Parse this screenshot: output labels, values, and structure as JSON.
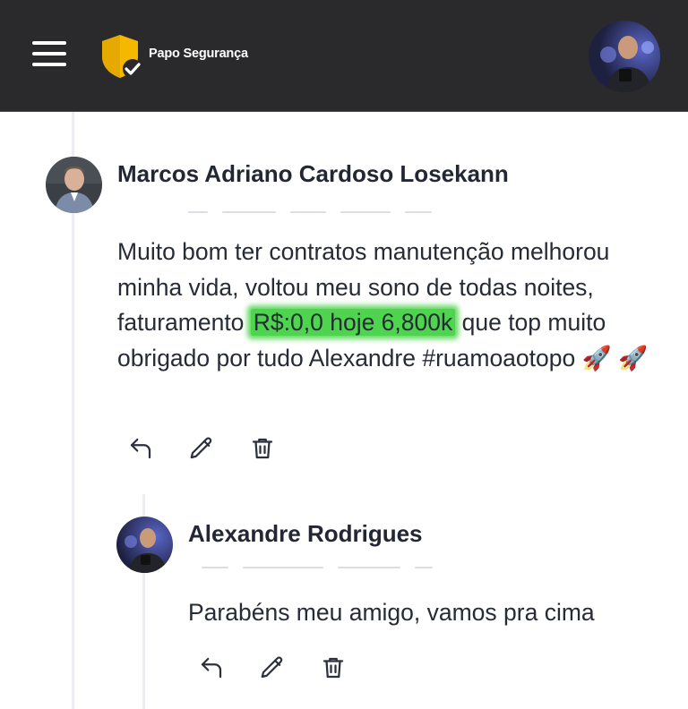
{
  "header": {
    "brand_name": "Papo Segurança",
    "menu_icon": "hamburger-menu-icon",
    "logo_icon": "shield-check-icon",
    "accent_color": "#f5b800"
  },
  "comments": [
    {
      "author": "Marcos Adriano Cardoso Losekann",
      "text_before": "Muito bom ter contratos manutenção melhorou minha vida, voltou meu sono de todas noites, faturamento ",
      "text_highlight": "R$:0,0 hoje 6,800k",
      "text_after": " que top muito obrigado por tudo Alexandre #ruamoaotopo 🚀 🚀",
      "highlight_color": "#4ed44e",
      "actions": [
        "reply-icon",
        "edit-pencil-icon",
        "delete-trash-icon"
      ]
    },
    {
      "author": "Alexandre Rodrigues",
      "text": "Parabéns meu amigo, vamos pra cima",
      "actions": [
        "reply-icon",
        "edit-pencil-icon",
        "delete-trash-icon"
      ]
    }
  ]
}
